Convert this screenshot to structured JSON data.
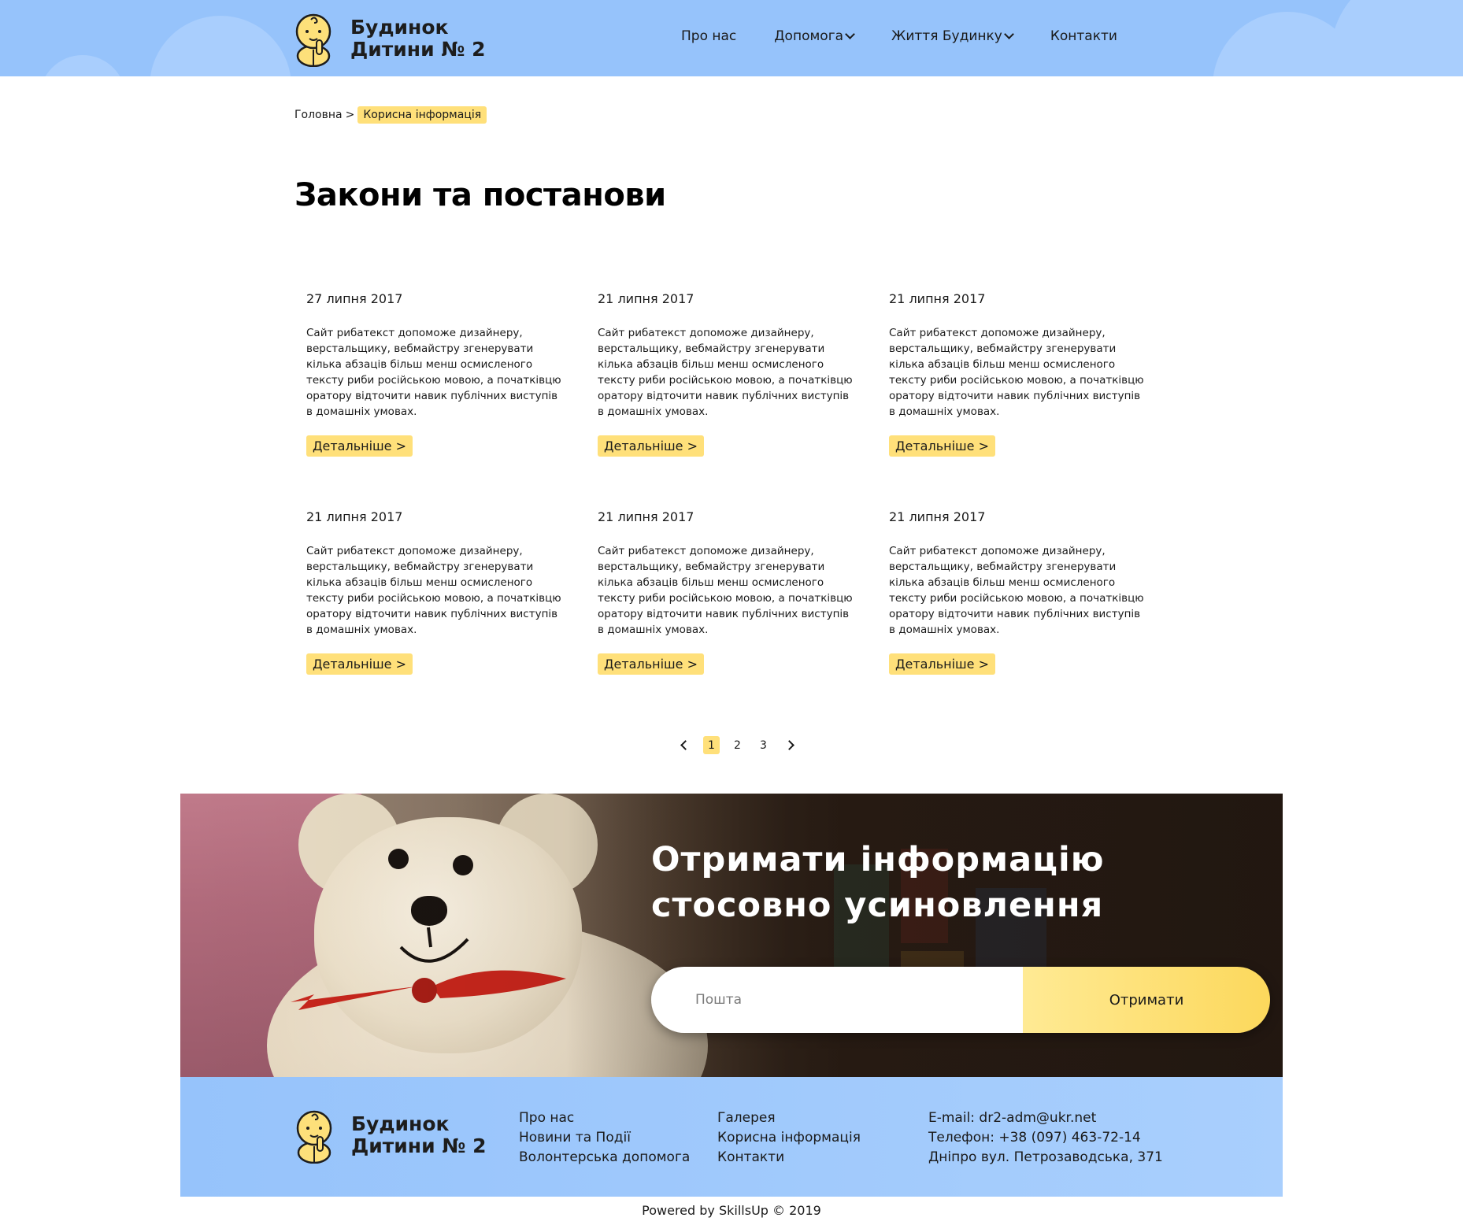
{
  "header": {
    "logo_line1": "Будинок",
    "logo_line2": "Дитини № 2",
    "nav": [
      {
        "label": "Про нас"
      },
      {
        "label": "Допомога"
      },
      {
        "label": "Життя Будинку"
      },
      {
        "label": "Контакти"
      }
    ]
  },
  "breadcrumb": {
    "home": "Головна",
    "separator": ">",
    "current": "Корисна інформація"
  },
  "page_title": "Закони та постанови",
  "cards": [
    {
      "date": "27 липня 2017",
      "text": "Сайт рибатекст допоможе дизайнеру, верстальщику, вебмайстру згенерувати кілька абзаців більш менш осмисленого тексту риби російською мовою, а початківцю оратору відточити навик публічних виступів в домашніх умовах.",
      "button": "Детальніше >"
    },
    {
      "date": "21 липня 2017",
      "text": "Сайт рибатекст допоможе дизайнеру, верстальщику, вебмайстру згенерувати кілька абзаців більш менш осмисленого тексту риби російською мовою, а початківцю оратору відточити навик публічних виступів в домашніх умовах.",
      "button": "Детальніше >"
    },
    {
      "date": "21 липня 2017",
      "text": "Сайт рибатекст допоможе дизайнеру, верстальщику, вебмайстру згенерувати кілька абзаців більш менш осмисленого тексту риби російською мовою, а початківцю оратору відточити навик публічних виступів в домашніх умовах.",
      "button": "Детальніше >"
    },
    {
      "date": "21 липня 2017",
      "text": "Сайт рибатекст допоможе дизайнеру, верстальщику, вебмайстру згенерувати кілька абзаців більш менш осмисленого тексту риби російською мовою, а початківцю оратору відточити навик публічних виступів в домашніх умовах.",
      "button": "Детальніше >"
    },
    {
      "date": "21 липня 2017",
      "text": "Сайт рибатекст допоможе дизайнеру, верстальщику, вебмайстру згенерувати кілька абзаців більш менш осмисленого тексту риби російською мовою, а початківцю оратору відточити навик публічних виступів в домашніх умовах.",
      "button": "Детальніше >"
    },
    {
      "date": "21 липня 2017",
      "text": "Сайт рибатекст допоможе дизайнеру, верстальщику, вебмайстру згенерувати кілька абзаців більш менш осмисленого тексту риби російською мовою, а початківцю оратору відточити навик публічних виступів в домашніх умовах.",
      "button": "Детальніше >"
    }
  ],
  "pagination": {
    "pages": [
      "1",
      "2",
      "3"
    ],
    "active": "1"
  },
  "subscribe": {
    "title": "Отримати інформацію стосовно усиновлення",
    "placeholder": "Пошта",
    "button": "Отримати"
  },
  "footer": {
    "logo_line1": "Будинок",
    "logo_line2": "Дитини № 2",
    "col1": [
      "Про нас",
      "Новини та Події",
      "Волонтерська допомога"
    ],
    "col2": [
      "Галерея",
      "Корисна інформація",
      "Контакти"
    ],
    "contacts": [
      "E-mail: dr2-adm@ukr.net",
      "Телефон: +38 (097) 463-72-14",
      "Дніпро вул. Петрозаводська, 371"
    ]
  },
  "powered_by": "Powered by SkillsUp © 2019",
  "colors": {
    "header_bg": "#96c3fb",
    "accent_yellow": "#ffe07a",
    "text": "#1a1a1a"
  },
  "icons": [
    "baby-logo-icon",
    "chevron-down-icon",
    "chevron-left-icon",
    "chevron-right-icon"
  ]
}
